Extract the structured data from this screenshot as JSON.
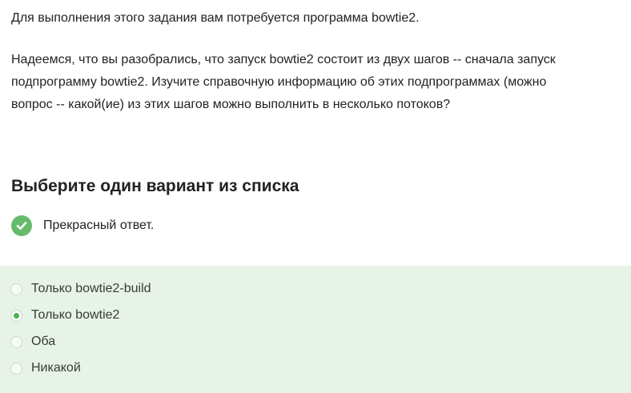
{
  "question": {
    "intro": "Для выполнения этого задания вам потребуется программа bowtie2.",
    "paragraph_lines": [
      "Надеемся, что вы разобрались, что запуск bowtie2 состоит из двух шагов -- сначала запуск",
      "подпрограмму bowtie2. Изучите справочную информацию об этих подпрограммах (можно",
      "вопрос -- какой(ие) из этих шагов можно выполнить в несколько потоков?"
    ]
  },
  "answer_section": {
    "title": "Выберите один вариант из списка",
    "status_text": "Прекрасный ответ.",
    "status_icon": "check-circle-icon",
    "status_color": "#66bb6a",
    "panel_color": "#e6f3e6",
    "options": [
      {
        "label": "Только bowtie2-build",
        "selected": false
      },
      {
        "label": "Только bowtie2",
        "selected": true
      },
      {
        "label": "Оба",
        "selected": false
      },
      {
        "label": "Никакой",
        "selected": false
      }
    ]
  }
}
